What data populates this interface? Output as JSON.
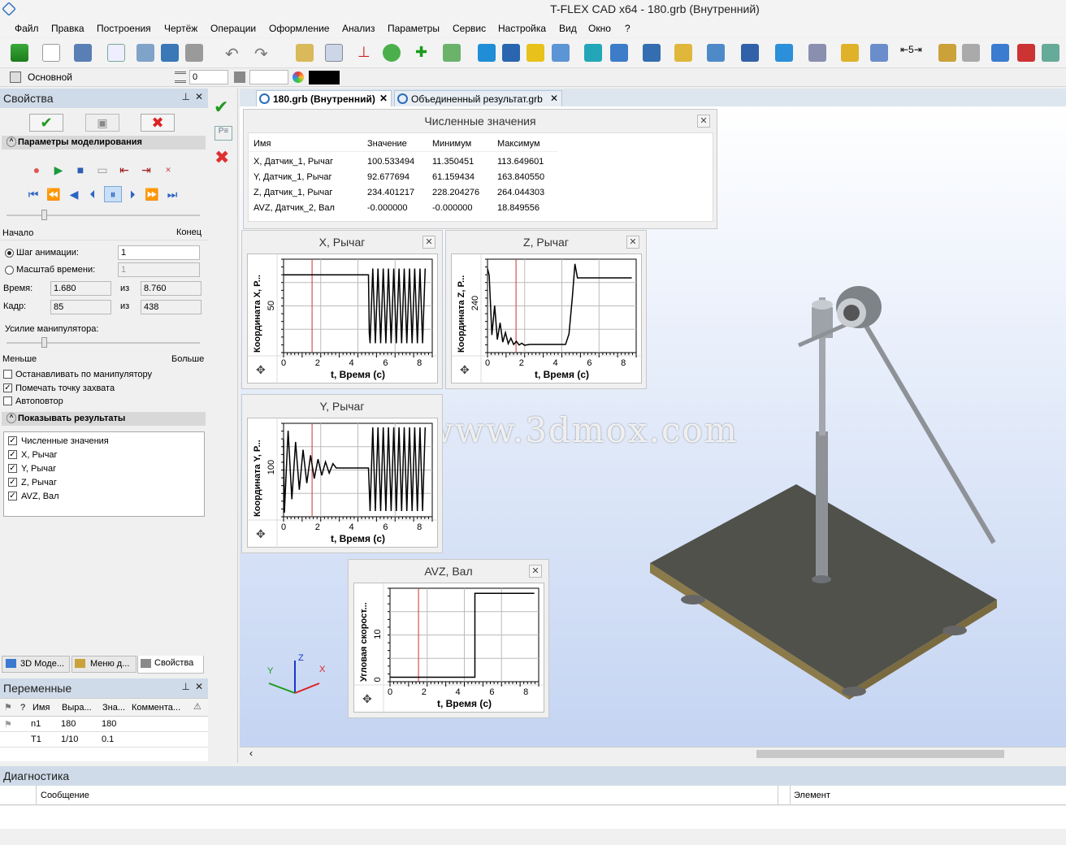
{
  "title": "T-FLEX CAD x64 - 180.grb (Внутренний)",
  "menu": [
    "Файл",
    "Правка",
    "Построения",
    "Чертёж",
    "Операции",
    "Оформление",
    "Анализ",
    "Параметры",
    "Сервис",
    "Настройка",
    "Вид",
    "Окно",
    "?"
  ],
  "propbar": {
    "layer": "Основной",
    "level": "0",
    "color": "#000000"
  },
  "left": {
    "title": "Свойства",
    "sim_section": "Параметры моделирования",
    "start": "Начало",
    "end": "Конец",
    "step_label": "Шаг анимации:",
    "step_value": "1",
    "scale_label": "Масштаб времени:",
    "scale_value": "1",
    "time_label": "Время:",
    "time_value": "1.680",
    "time_of": "из",
    "time_total": "8.760",
    "frame_label": "Кадр:",
    "frame_value": "85",
    "frame_of": "из",
    "frame_total": "438",
    "force_label": "Усилие манипулятора:",
    "less": "Меньше",
    "more": "Больше",
    "checks": [
      {
        "label": "Останавливать по манипулятору",
        "checked": false
      },
      {
        "label": "Помечать точку захвата",
        "checked": true
      },
      {
        "label": "Автоповтор",
        "checked": false
      }
    ],
    "results_section": "Показывать результаты",
    "results": [
      "Численные значения",
      "X, Рычаг",
      "Y, Рычаг",
      "Z, Рычаг",
      "AVZ, Вал"
    ],
    "tabs": [
      "3D Моде...",
      "Меню д...",
      "Свойства"
    ]
  },
  "vars": {
    "title": "Переменные",
    "cols": [
      "?",
      "Имя",
      "Выра...",
      "Зна...",
      "Коммента..."
    ],
    "rows": [
      [
        "n1",
        "180",
        "180",
        ""
      ],
      [
        "T1",
        "1/10",
        "0.1",
        ""
      ]
    ]
  },
  "doc_tabs": [
    "180.grb (Внутренний)",
    "Объединенный результат.grb"
  ],
  "numeric": {
    "title": "Численные значения",
    "cols": [
      "Имя",
      "Значение",
      "Минимум",
      "Максимум"
    ],
    "rows": [
      [
        "X, Датчик_1, Рычаг",
        "100.533494",
        "11.350451",
        "113.649601"
      ],
      [
        "Y, Датчик_1, Рычаг",
        "92.677694",
        "61.159434",
        "163.840550"
      ],
      [
        "Z, Датчик_1, Рычаг",
        "234.401217",
        "228.204276",
        "264.044303"
      ],
      [
        "AVZ, Датчик_2, Вал",
        "-0.000000",
        "-0.000000",
        "18.849556"
      ]
    ]
  },
  "plots": {
    "x": {
      "title": "X, Рычаг",
      "ylabel": "Координата X, Р...",
      "ytick": "50",
      "xlabel": "t, Время (с)",
      "xticks": [
        "0",
        "2",
        "4",
        "6",
        "8"
      ]
    },
    "z": {
      "title": "Z, Рычаг",
      "ylabel": "Координата Z, Р...",
      "ytick": "240",
      "xlabel": "t, Время (с)",
      "xticks": [
        "0",
        "2",
        "4",
        "6",
        "8"
      ]
    },
    "y": {
      "title": "Y, Рычаг",
      "ylabel": "Координата Y, Р...",
      "ytick": "100",
      "xlabel": "t, Время (с)",
      "xticks": [
        "0",
        "2",
        "4",
        "6",
        "8"
      ]
    },
    "avz": {
      "title": "AVZ, Вал",
      "ylabel": "Угловая скорост...",
      "yticks": [
        "10",
        "0"
      ],
      "xlabel": "t, Время (с)",
      "xticks": [
        "0",
        "2",
        "4",
        "6",
        "8"
      ]
    }
  },
  "chart_data": [
    {
      "type": "line",
      "title": "X, Рычаг",
      "xlabel": "t, Время (с)",
      "ylabel": "Координата X, Р...",
      "xlim": [
        0,
        8.76
      ],
      "ylim": [
        0,
        120
      ],
      "current_time": 1.68,
      "segments": [
        [
          [
            0,
            100
          ],
          [
            5,
            100
          ]
        ],
        [
          [
            5,
            100
          ],
          [
            5.2,
            10
          ],
          [
            5.4,
            110
          ]
        ]
      ],
      "osc": {
        "from": 5.2,
        "to": 8.5,
        "low": 10,
        "high": 112,
        "count": 22
      }
    },
    {
      "type": "line",
      "title": "Z, Рычаг",
      "xlabel": "t, Время (с)",
      "ylabel": "Координата Z, Р...",
      "xlim": [
        0,
        8.76
      ],
      "ylim": [
        226,
        266
      ],
      "current_time": 1.68
    },
    {
      "type": "line",
      "title": "Y, Рычаг",
      "xlabel": "t, Время (с)",
      "ylabel": "Координата Y, Р...",
      "xlim": [
        0,
        8.76
      ],
      "ylim": [
        55,
        170
      ],
      "current_time": 1.68
    },
    {
      "type": "line",
      "title": "AVZ, Вал",
      "xlabel": "t, Время (с)",
      "ylabel": "Угловая скорост...",
      "xlim": [
        0,
        8.76
      ],
      "ylim": [
        -1,
        20
      ],
      "current_time": 1.68,
      "points": [
        [
          0,
          0
        ],
        [
          5,
          0
        ],
        [
          5,
          18.85
        ],
        [
          8.5,
          18.85
        ]
      ]
    }
  ],
  "axes": {
    "x": "X",
    "y": "Y",
    "z": "Z"
  },
  "watermark": "吴西网www.3dmox.com",
  "diag": {
    "title": "Диагностика",
    "col1": "Сообщение",
    "col2": "Элемент"
  }
}
